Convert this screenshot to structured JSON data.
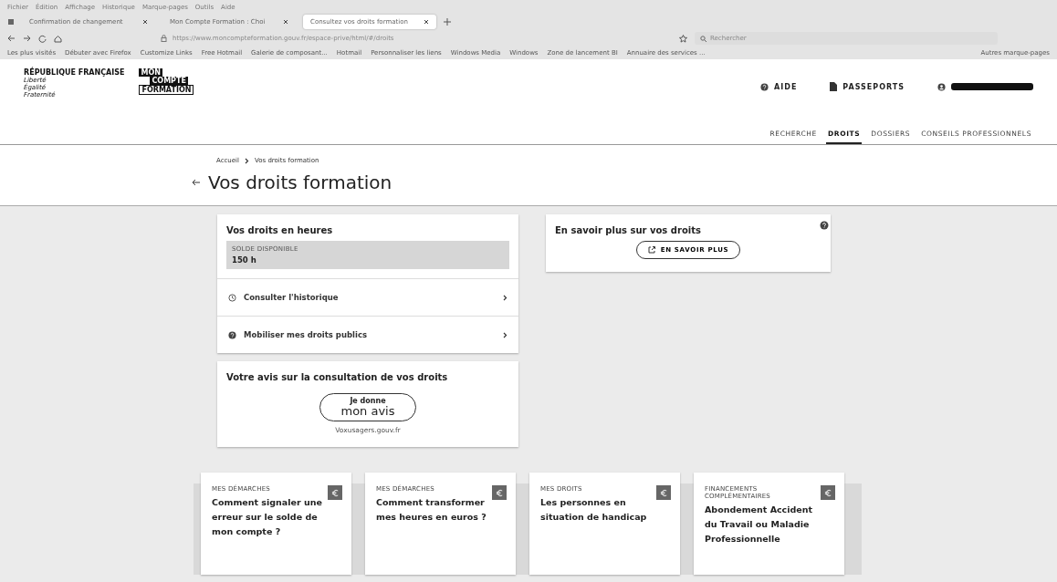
{
  "menu_bar": [
    "Fichier",
    "Édition",
    "Affichage",
    "Historique",
    "Marque-pages",
    "Outils",
    "Aide"
  ],
  "browser_tabs": [
    {
      "label": "Confirmation de changement",
      "selected": false
    },
    {
      "label": "Mon Compte Formation : Choi",
      "selected": false
    },
    {
      "label": "Consultez vos droits formation",
      "selected": true
    }
  ],
  "address_bar": {
    "url": "https://www.moncompteformation.gouv.fr/espace-prive/html/#/droits"
  },
  "search_field": {
    "placeholder": "Rechercher"
  },
  "bookmarks": [
    "Les plus visités",
    "Débuter avec Firefox",
    "Customize Links",
    "Free Hotmail",
    "Galerie de composant...",
    "Hotmail",
    "Personnaliser les liens",
    "Windows Media",
    "Windows",
    "Zone de lancement BI",
    "Annuaire des services ..."
  ],
  "other_bookmarks": "Autres marque-pages",
  "site_header": {
    "gov_logo": {
      "title": "RÉPUBLIQUE FRANÇAISE",
      "motto": [
        "Liberté",
        "Égalité",
        "Fraternité"
      ]
    },
    "brand_logo": [
      "MON",
      "COMPTE",
      "FORMATION"
    ],
    "actions": [
      "AIDE",
      "PASSEPORTS"
    ],
    "nav": [
      {
        "label": "RECHERCHE",
        "selected": false
      },
      {
        "label": "DROITS",
        "selected": true
      },
      {
        "label": "DOSSIERS",
        "selected": false
      },
      {
        "label": "CONSEILS PROFESSIONNELS",
        "selected": false
      }
    ]
  },
  "breadcrumb": [
    "Accueil",
    "Vos droits formation"
  ],
  "page_title": "Vos droits formation",
  "rights_card": {
    "title": "Vos droits en heures",
    "balance_label": "SOLDE DISPONIBLE",
    "balance": "150 h",
    "links": [
      {
        "kind": "history",
        "label": "Consulter l'historique"
      },
      {
        "kind": "help",
        "label": "Mobiliser mes droits publics"
      }
    ]
  },
  "info_card": {
    "title": "En savoir plus sur vos droits",
    "button": "EN SAVOIR PLUS"
  },
  "feedback_card": {
    "title": "Votre avis sur la consultation de vos droits",
    "button": [
      "Je donne",
      "mon avis"
    ],
    "source": "Voxusagers.gouv.fr"
  },
  "articles": [
    {
      "category": "MES DÉMARCHES",
      "title": "Comment signaler une erreur sur le solde de mon compte ?"
    },
    {
      "category": "MES DÉMARCHES",
      "title": "Comment transformer mes heures en euros ?"
    },
    {
      "category": "MES DROITS",
      "title": "Les personnes en situation de handicap"
    },
    {
      "category": "FINANCEMENTS COMPLÉMENTAIRES",
      "title": "Abondement Accident du Travail ou Maladie Professionnelle"
    }
  ]
}
